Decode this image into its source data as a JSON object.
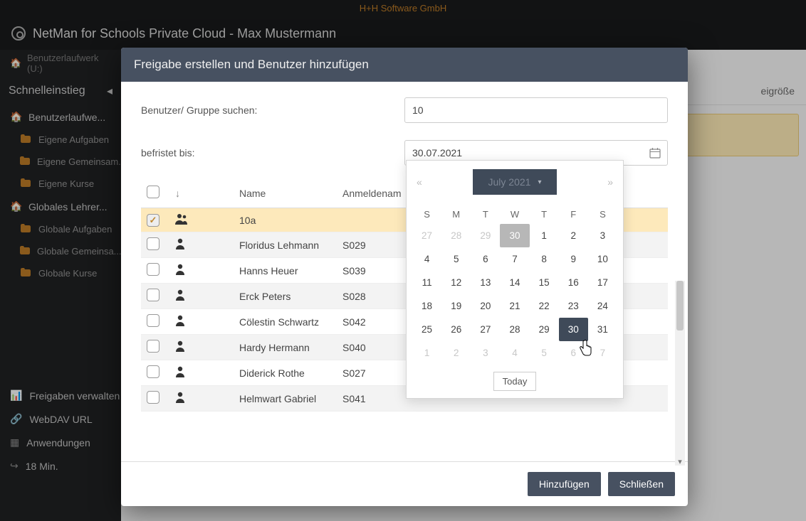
{
  "company": "H+H Software GmbH",
  "app_title": "NetMan for Schools Private Cloud - Max Mustermann",
  "breadcrumb": "Benutzerlaufwerk (U:)",
  "sidebar": {
    "heading": "Schnelleinstieg",
    "group1_label": "Benutzerlaufwe...",
    "group1_items": [
      "Eigene Aufgaben",
      "Eigene Gemeinsam...",
      "Eigene Kurse"
    ],
    "group2_label": "Globales Lehrer...",
    "group2_items": [
      "Globale Aufgaben",
      "Globale Gemeinsa...",
      "Globale Kurse"
    ],
    "bottom_items": [
      "Freigaben verwalten",
      "WebDAV URL",
      "Anwendungen",
      "18 Min."
    ]
  },
  "bg_header": {
    "col": "eigröße"
  },
  "modal": {
    "title": "Freigabe erstellen und Benutzer hinzufügen",
    "search_label": "Benutzer/ Gruppe suchen:",
    "search_value": "10",
    "date_label": "befristet bis:",
    "date_value": "30.07.2021",
    "columns": {
      "name": "Name",
      "login": "Anmeldenam"
    },
    "rows": [
      {
        "checked": true,
        "type": "group",
        "name": "10a",
        "login": ""
      },
      {
        "checked": false,
        "type": "user",
        "name": "Floridus Lehmann",
        "login": "S029"
      },
      {
        "checked": false,
        "type": "user",
        "name": "Hanns Heuer",
        "login": "S039"
      },
      {
        "checked": false,
        "type": "user",
        "name": "Erck Peters",
        "login": "S028"
      },
      {
        "checked": false,
        "type": "user",
        "name": "Cölestin Schwartz",
        "login": "S042"
      },
      {
        "checked": false,
        "type": "user",
        "name": "Hardy Hermann",
        "login": "S040"
      },
      {
        "checked": false,
        "type": "user",
        "name": "Diderick Rothe",
        "login": "S027"
      },
      {
        "checked": false,
        "type": "user",
        "name": "Helmwart Gabriel",
        "login": "S041"
      }
    ],
    "buttons": {
      "add": "Hinzufügen",
      "close": "Schließen"
    }
  },
  "datepicker": {
    "month_label": "July 2021",
    "dow": [
      "S",
      "M",
      "T",
      "W",
      "T",
      "F",
      "S"
    ],
    "weeks": [
      [
        {
          "d": 27,
          "o": true
        },
        {
          "d": 28,
          "o": true
        },
        {
          "d": 29,
          "o": true
        },
        {
          "d": 30,
          "o": true,
          "hl": true
        },
        {
          "d": 1
        },
        {
          "d": 2
        },
        {
          "d": 3
        }
      ],
      [
        {
          "d": 4
        },
        {
          "d": 5
        },
        {
          "d": 6
        },
        {
          "d": 7
        },
        {
          "d": 8
        },
        {
          "d": 9
        },
        {
          "d": 10
        }
      ],
      [
        {
          "d": 11
        },
        {
          "d": 12
        },
        {
          "d": 13
        },
        {
          "d": 14
        },
        {
          "d": 15
        },
        {
          "d": 16
        },
        {
          "d": 17
        }
      ],
      [
        {
          "d": 18
        },
        {
          "d": 19
        },
        {
          "d": 20
        },
        {
          "d": 21
        },
        {
          "d": 22
        },
        {
          "d": 23
        },
        {
          "d": 24
        }
      ],
      [
        {
          "d": 25
        },
        {
          "d": 26
        },
        {
          "d": 27
        },
        {
          "d": 28
        },
        {
          "d": 29
        },
        {
          "d": 30,
          "sel": true
        },
        {
          "d": 31
        }
      ],
      [
        {
          "d": 1,
          "o": true
        },
        {
          "d": 2,
          "o": true
        },
        {
          "d": 3,
          "o": true
        },
        {
          "d": 4,
          "o": true
        },
        {
          "d": 5,
          "o": true
        },
        {
          "d": 6,
          "o": true
        },
        {
          "d": 7,
          "o": true
        }
      ]
    ],
    "today_label": "Today"
  }
}
